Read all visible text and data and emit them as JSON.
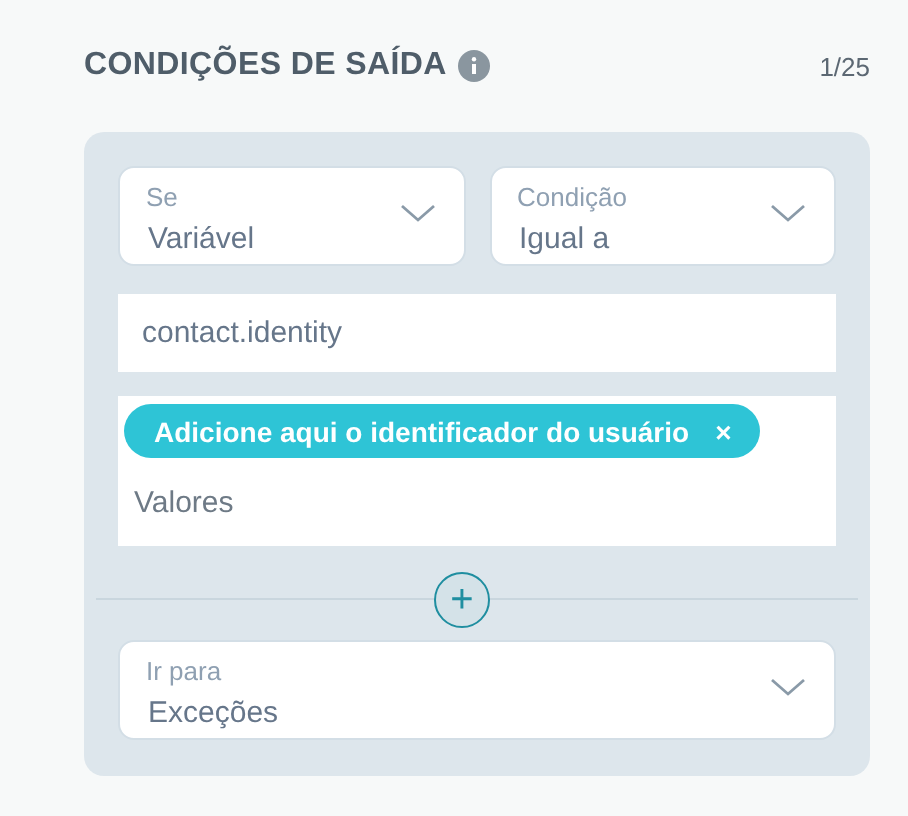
{
  "header": {
    "title": "CONDIÇÕES DE SAÍDA",
    "counter": "1/25"
  },
  "conditions": [
    {
      "label": "Se",
      "value": "Variável"
    },
    {
      "label": "Condição",
      "value": "Igual a"
    }
  ],
  "variable_field": {
    "value": "contact.identity"
  },
  "values_field": {
    "tags": [
      {
        "label": "Adicione aqui o identificador do usuário",
        "remove": "×"
      }
    ],
    "placeholder": "Valores"
  },
  "add_button": {
    "label": "+"
  },
  "goto": {
    "label": "Ir para",
    "value": "Exceções"
  }
}
